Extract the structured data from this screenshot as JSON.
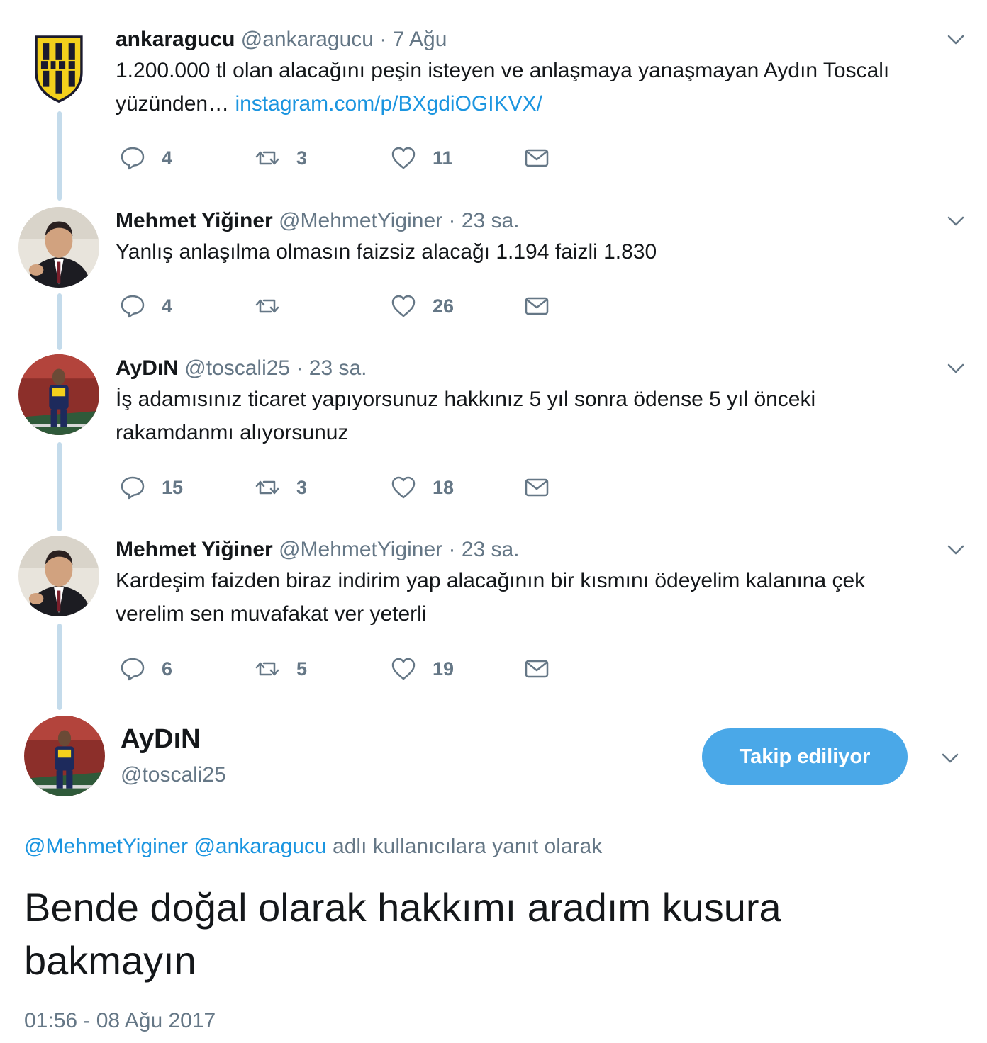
{
  "tweets": [
    {
      "name": "ankaragucu",
      "handle": "@ankaragucu",
      "time": "7 Ağu",
      "text": "1.200.000 tl olan alacağını peşin isteyen ve anlaşmaya yanaşmayan Aydın Toscalı yüzünden… ",
      "link": "instagram.com/p/BXgdiOGIKVX/",
      "replies": "4",
      "retweets": "3",
      "likes": "11"
    },
    {
      "name": "Mehmet Yiğiner",
      "handle": "@MehmetYiginer",
      "time": "23 sa.",
      "text": "Yanlış anlaşılma olmasın faizsiz alacağı 1.194 faizli 1.830",
      "replies": "4",
      "retweets": "",
      "likes": "26"
    },
    {
      "name": "AyDıN",
      "handle": "@toscali25",
      "time": "23 sa.",
      "text": "İş adamısınız ticaret yapıyorsunuz hakkınız 5 yıl sonra ödense 5 yıl önceki rakamdanmı alıyorsunuz",
      "replies": "15",
      "retweets": "3",
      "likes": "18"
    },
    {
      "name": "Mehmet Yiğiner",
      "handle": "@MehmetYiginer",
      "time": "23 sa.",
      "text": "Kardeşim faizden biraz indirim yap alacağının bir kısmını ödeyelim kalanına çek verelim sen muvafakat ver yeterli",
      "replies": "6",
      "retweets": "5",
      "likes": "19"
    }
  ],
  "separator": "·",
  "main_tweet": {
    "name": "AyDıN",
    "handle": "@toscali25",
    "follow_label": "Takip ediliyor",
    "reply_mentions": [
      "@MehmetYiginer",
      "@ankaragucu"
    ],
    "reply_suffix": "adlı kullanıcılara yanıt olarak",
    "text": "Bende doğal olarak hakkımı aradım kusura bakmayın",
    "timestamp": "01:56 - 08 Ağu 2017"
  },
  "colors": {
    "link": "#1b95e0",
    "secondary_text": "#657786",
    "thread_line": "#c4dbeb",
    "follow_button": "#4aa8e8"
  },
  "icons": [
    "reply-icon",
    "retweet-icon",
    "like-icon",
    "direct-message-icon",
    "chevron-down-icon"
  ]
}
